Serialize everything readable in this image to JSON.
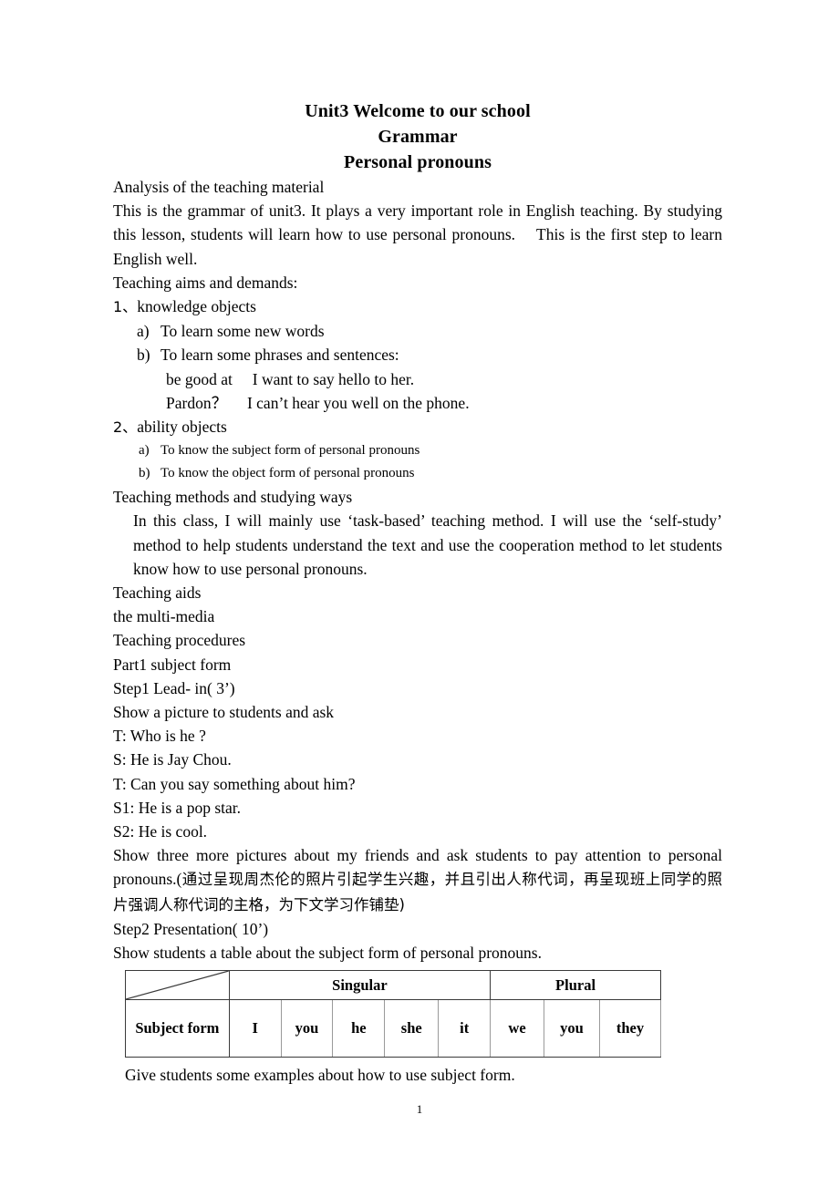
{
  "document": {
    "titles": [
      "Unit3 Welcome to our school",
      "Grammar",
      "Personal pronouns"
    ],
    "sections": {
      "analysis_heading": "Analysis of the teaching material",
      "analysis_body": "This is the grammar of unit3. It plays a very important role in English teaching. By studying this lesson, students will learn how to use personal pronouns.  This is the first step to learn English well.",
      "aims_heading": "Teaching aims and demands:",
      "item1_number": "1、",
      "item1_label": "knowledge objects",
      "item1_a_marker": "a)",
      "item1_a_text": "To learn some new words",
      "item1_b_marker": "b)",
      "item1_b_text": "To learn some phrases and sentences:",
      "example1": "be good at  I want to say hello to her.",
      "example2": "Pardon？   I can’t hear you well on the phone.",
      "item2_number": "2、",
      "item2_label": "ability objects",
      "item2_a_marker": "a)",
      "item2_a_text": "To know the subject form of personal pronouns",
      "item2_b_marker": "b)",
      "item2_b_text": "To know the object form of personal pronouns",
      "methods_heading": "Teaching methods and studying ways",
      "methods_body": "In this class, I will mainly use ‘task-based’ teaching method. I will use the ‘self-study’ method to help students understand the text and use the cooperation method to let students know how to use personal pronouns.",
      "aids_heading": "Teaching aids",
      "aids_body": "the multi-media",
      "procedures_heading": "Teaching procedures",
      "part1": "Part1 subject form",
      "step1": "Step1 Lead- in( 3’)",
      "show_picture": "Show a picture to students and ask",
      "dialogue": [
        "T: Who is he ?",
        "S: He is Jay Chou.",
        "T: Can you say something about him?",
        "S1: He is a pop star.",
        "S2: He is cool."
      ],
      "show_three_en": "Show three more pictures about my friends and ask students to pay attention to personal pronouns.(",
      "show_three_cn": "通过呈现周杰伦的照片引起学生兴趣，并且引出人称代词，再呈现班上同学的照片强调人称代词的主格，为下文学习作铺垫)",
      "step2": "Step2 Presentation( 10’)",
      "show_table_line": "Show students a table about the subject form of personal pronouns.",
      "closing_line": "Give students some examples about how to use subject form."
    },
    "table": {
      "corner_label": "",
      "group_headers": [
        {
          "label": "Singular",
          "span": 5
        },
        {
          "label": "Plural",
          "span": 3
        }
      ],
      "row_label": "Subject form",
      "pronouns": [
        "I",
        "you",
        "he",
        "she",
        "it",
        "we",
        "you",
        "they"
      ]
    },
    "page_number": "1"
  }
}
